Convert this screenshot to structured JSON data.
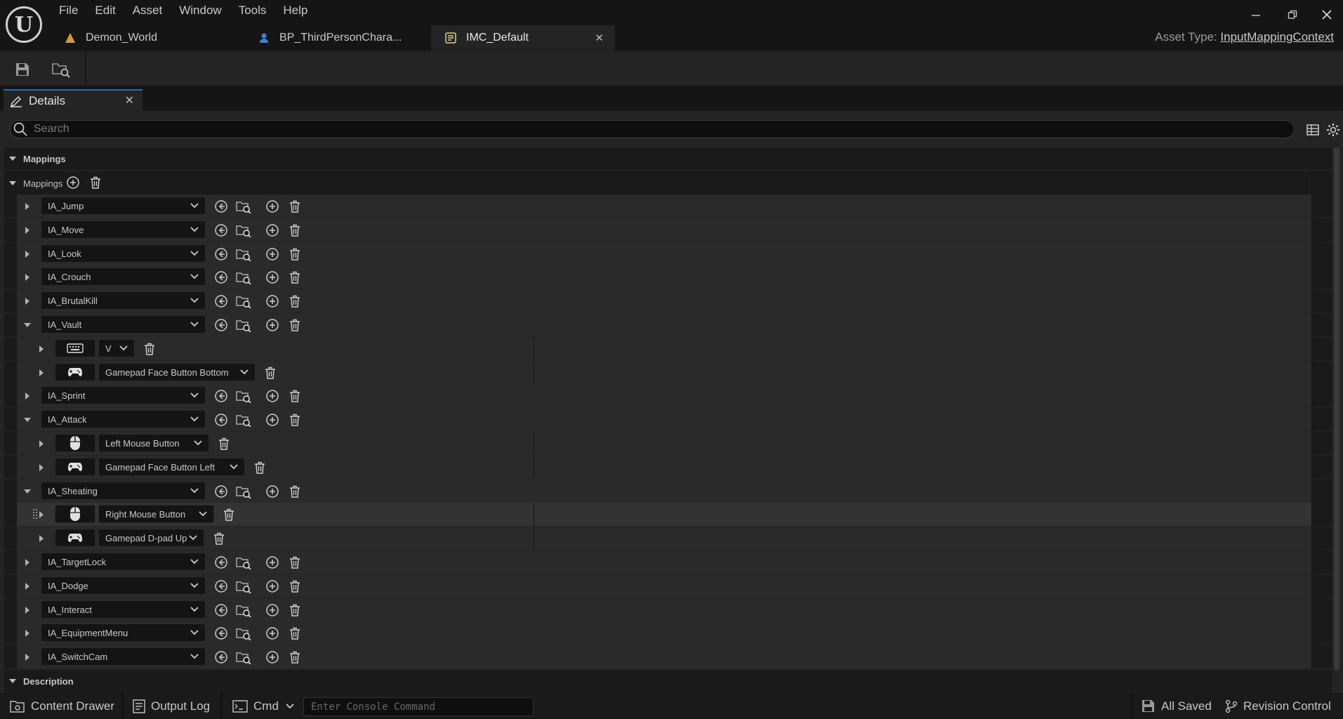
{
  "window": {
    "menu": [
      "File",
      "Edit",
      "Asset",
      "Window",
      "Tools",
      "Help"
    ],
    "tabs": [
      {
        "label": "Demon_World",
        "icon": "level-icon"
      },
      {
        "label": "BP_ThirdPersonChara...",
        "icon": "character-blueprint-icon"
      },
      {
        "label": "IMC_Default",
        "icon": "input-mapping-icon",
        "active": true
      }
    ],
    "asset_type_label": "Asset Type:",
    "asset_type_value": "InputMappingContext"
  },
  "details": {
    "tab_label": "Details",
    "search_placeholder": "Search",
    "category_mappings": "Mappings",
    "mappings_array_label": "Mappings",
    "category_description": "Description"
  },
  "mappings": [
    {
      "action": "IA_Jump",
      "expanded": false
    },
    {
      "action": "IA_Move",
      "expanded": false
    },
    {
      "action": "IA_Look",
      "expanded": false
    },
    {
      "action": "IA_Crouch",
      "expanded": false
    },
    {
      "action": "IA_BrutalKill",
      "expanded": false
    },
    {
      "action": "IA_Vault",
      "expanded": true,
      "keys": [
        {
          "device": "keyboard",
          "key": "V"
        },
        {
          "device": "gamepad",
          "key": "Gamepad Face Button Bottom"
        }
      ]
    },
    {
      "action": "IA_Sprint",
      "expanded": false
    },
    {
      "action": "IA_Attack",
      "expanded": true,
      "keys": [
        {
          "device": "mouse",
          "key": "Left Mouse Button"
        },
        {
          "device": "gamepad",
          "key": "Gamepad Face Button Left"
        }
      ]
    },
    {
      "action": "IA_Sheating",
      "expanded": true,
      "keys": [
        {
          "device": "mouse",
          "key": "Right Mouse Button",
          "hovered": true
        },
        {
          "device": "gamepad",
          "key": "Gamepad D-pad Up"
        }
      ]
    },
    {
      "action": "IA_TargetLock",
      "expanded": false
    },
    {
      "action": "IA_Dodge",
      "expanded": false
    },
    {
      "action": "IA_Interact",
      "expanded": false
    },
    {
      "action": "IA_EquipmentMenu",
      "expanded": false
    },
    {
      "action": "IA_SwitchCam",
      "expanded": false
    }
  ],
  "bottombar": {
    "content_drawer": "Content Drawer",
    "output_log": "Output Log",
    "cmd": "Cmd",
    "console_placeholder": "Enter Console Command",
    "all_saved": "All Saved",
    "revision_control": "Revision Control"
  },
  "colors": {
    "accent": "#2a6ab5",
    "panel": "#242424",
    "row": "#1a1a1a",
    "field": "#141414"
  }
}
